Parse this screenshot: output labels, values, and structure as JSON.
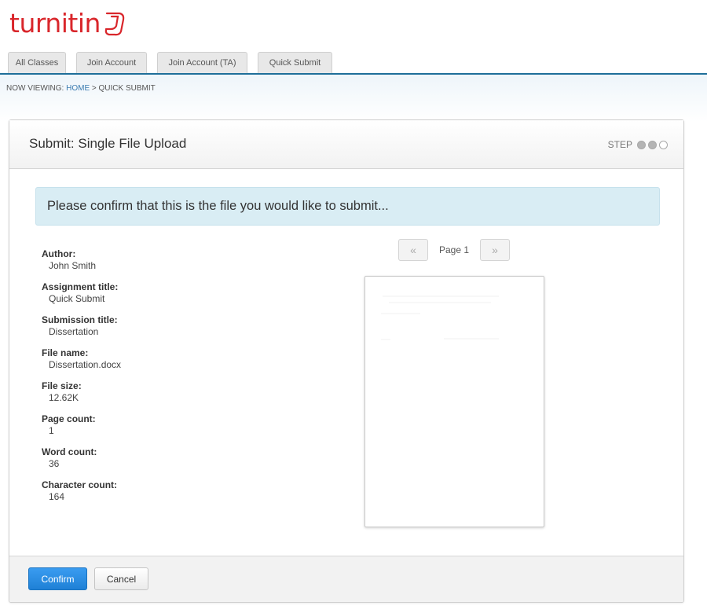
{
  "brand": {
    "logo_text": "turnitin",
    "color": "#d9262b"
  },
  "tabs": [
    {
      "label": "All Classes"
    },
    {
      "label": "Join Account"
    },
    {
      "label": "Join Account (TA)"
    },
    {
      "label": "Quick Submit"
    }
  ],
  "breadcrumb": {
    "prefix": "NOW VIEWING:",
    "home": "HOME",
    "separator": ">",
    "current": "QUICK SUBMIT"
  },
  "panel": {
    "title": "Submit: Single File Upload",
    "step_label": "STEP",
    "steps_total": 3,
    "steps_done": 2
  },
  "alert": {
    "message": "Please confirm that this is the file you would like to submit..."
  },
  "details": [
    {
      "label": "Author:",
      "value": "John Smith"
    },
    {
      "label": "Assignment title:",
      "value": "Quick Submit"
    },
    {
      "label": "Submission title:",
      "value": "Dissertation"
    },
    {
      "label": "File name:",
      "value": "Dissertation.docx"
    },
    {
      "label": "File size:",
      "value": "12.62K"
    },
    {
      "label": "Page count:",
      "value": "1"
    },
    {
      "label": "Word count:",
      "value": "36"
    },
    {
      "label": "Character count:",
      "value": "164"
    }
  ],
  "pager": {
    "prev": "«",
    "label": "Page 1",
    "next": "»"
  },
  "buttons": {
    "confirm": "Confirm",
    "cancel": "Cancel"
  },
  "colors": {
    "accent": "#1f6f99",
    "confirm": "#2a8de3",
    "alert_bg": "#d9edf4"
  }
}
